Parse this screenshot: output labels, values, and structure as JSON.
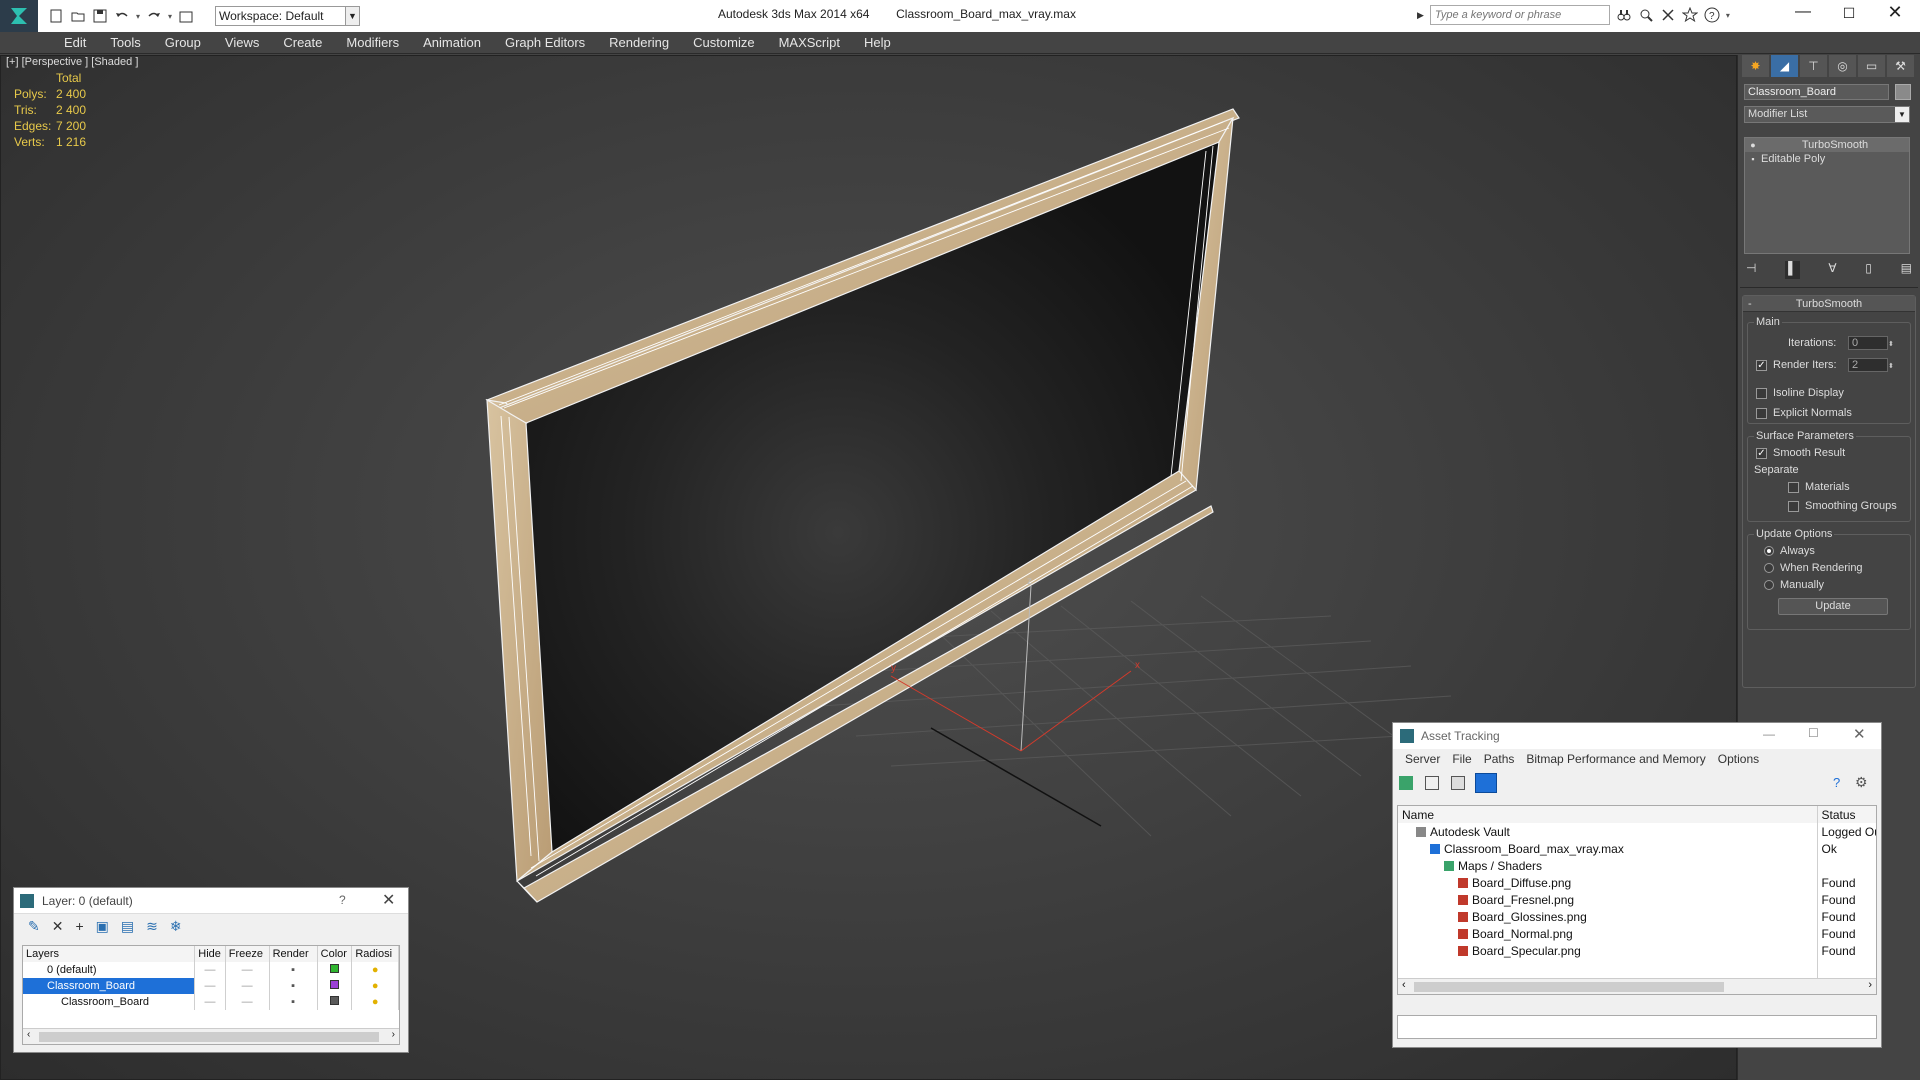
{
  "titlebar": {
    "app": "Autodesk 3ds Max  2014 x64",
    "file": "Classroom_Board_max_vray.max",
    "workspace": "Workspace: Default",
    "search_placeholder": "Type a keyword or phrase"
  },
  "menu": [
    "Edit",
    "Tools",
    "Group",
    "Views",
    "Create",
    "Modifiers",
    "Animation",
    "Graph Editors",
    "Rendering",
    "Customize",
    "MAXScript",
    "Help"
  ],
  "viewport": {
    "label": "[+] [Perspective ] [Shaded ]",
    "stats": {
      "total_label": "Total",
      "rows": [
        {
          "label": "Polys:",
          "value": "2 400"
        },
        {
          "label": "Tris:",
          "value": "2 400"
        },
        {
          "label": "Edges:",
          "value": "7 200"
        },
        {
          "label": "Verts:",
          "value": "1 216"
        }
      ]
    },
    "gizmo": {
      "x": "x",
      "y": "y",
      "z": "z"
    }
  },
  "command_panel": {
    "object_name": "Classroom_Board",
    "modifier_list": "Modifier List",
    "stack": [
      "TurboSmooth",
      "Editable Poly"
    ],
    "rollout": {
      "title": "TurboSmooth",
      "main": "Main",
      "iterations_label": "Iterations:",
      "iterations_value": "0",
      "render_iters_label": "Render Iters:",
      "render_iters_value": "2",
      "isoline": "Isoline Display",
      "explicit": "Explicit Normals",
      "surface_params": "Surface Parameters",
      "smooth_result": "Smooth Result",
      "separate": "Separate",
      "materials": "Materials",
      "smoothing_groups": "Smoothing Groups",
      "update_options": "Update Options",
      "always": "Always",
      "when_rendering": "When Rendering",
      "manually": "Manually",
      "update_btn": "Update"
    }
  },
  "layer_window": {
    "title": "Layer: 0 (default)",
    "help": "?",
    "columns": [
      "Layers",
      "Hide",
      "Freeze",
      "Render",
      "Color",
      "Radiosi"
    ],
    "rows": [
      {
        "name": "0 (default)",
        "color": "#2fb52f"
      },
      {
        "name": "Classroom_Board",
        "color": "#9b3fd6"
      },
      {
        "name": "Classroom_Board",
        "color": "#5a5a5a"
      }
    ]
  },
  "asset_window": {
    "title": "Asset Tracking",
    "menu": [
      "Server",
      "File",
      "Paths",
      "Bitmap Performance and Memory",
      "Options"
    ],
    "columns": [
      "Name",
      "Status"
    ],
    "rows": [
      {
        "name": "Autodesk Vault",
        "status": "Logged Ou"
      },
      {
        "name": "Classroom_Board_max_vray.max",
        "status": "Ok"
      },
      {
        "name": "Maps / Shaders",
        "status": ""
      },
      {
        "name": "Board_Diffuse.png",
        "status": "Found"
      },
      {
        "name": "Board_Fresnel.png",
        "status": "Found"
      },
      {
        "name": "Board_Glossines.png",
        "status": "Found"
      },
      {
        "name": "Board_Normal.png",
        "status": "Found"
      },
      {
        "name": "Board_Specular.png",
        "status": "Found"
      }
    ]
  },
  "colors": {
    "accent": "#0078d7",
    "selection": "#1e70d8",
    "stat_yellow": "#e7c94a"
  }
}
